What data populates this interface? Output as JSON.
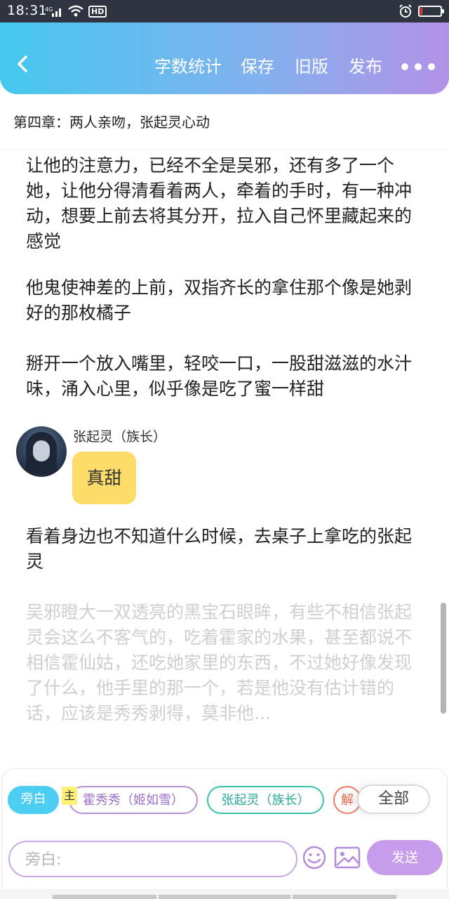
{
  "status_bar": {
    "time": "18:31",
    "signal_label": "4G",
    "hd_label": "HD",
    "battery_level": 0.08,
    "colors": {
      "background": "#2f3441",
      "battery_low": "#ff2b2b"
    }
  },
  "header": {
    "back_icon": "chevron-left-icon",
    "actions": {
      "word_count": "字数统计",
      "save": "保存",
      "old_version": "旧版",
      "publish": "发布"
    },
    "more_icon": "more-horizontal-icon",
    "gradient": [
      "#45c8ef",
      "#7fb2ee",
      "#b392e8"
    ]
  },
  "chapter": {
    "title": "第四章：两人亲吻，张起灵心动"
  },
  "content": {
    "paragraphs": [
      "让他的注意力，已经不全是吴邪，还有多了一个她，让他分得清看着两人，牵着的手时，有一种冲动，想要上前去将其分开，拉入自己怀里藏起来的感觉",
      "他鬼使神差的上前，双指齐长的拿住那个像是她剥好的那枚橘子",
      "掰开一个放入嘴里，轻咬一口，一股甜滋滋的水汁味，涌入心里，似乎像是吃了蜜一样甜"
    ],
    "dialog": {
      "speaker": "张起灵（族长）",
      "text": "真甜",
      "bubble_color": "#fedc6a"
    },
    "paragraph_after": "看着身边也不知道什么时候，去桌子上拿吃的张起灵",
    "faded_paragraph": "吴邪瞪大一双透亮的黑宝石眼眸，有些不相信张起灵会这么不客气的，吃着霍家的水果，甚至都说不相信霍仙姑，还吃她家里的东西，不过她好像发现了什么，他手里的那一个，若是他没有估计错的话，应该是秀秀剥得，莫非他..."
  },
  "characters": {
    "narration": "旁白",
    "main_tag": "主",
    "items": [
      "霍秀秀（姬如雪）",
      "张起灵（族长）",
      "解"
    ],
    "all_button": "全部",
    "colors": {
      "narration": "#4ccdf2",
      "main": "#b78fd8",
      "zhang": "#35c2ad",
      "cut": "#f07a5e"
    }
  },
  "composer": {
    "placeholder": "旁白:",
    "emoji_icon": "smile-icon",
    "image_icon": "image-icon",
    "send": "发送",
    "send_color": "#c79cea"
  }
}
